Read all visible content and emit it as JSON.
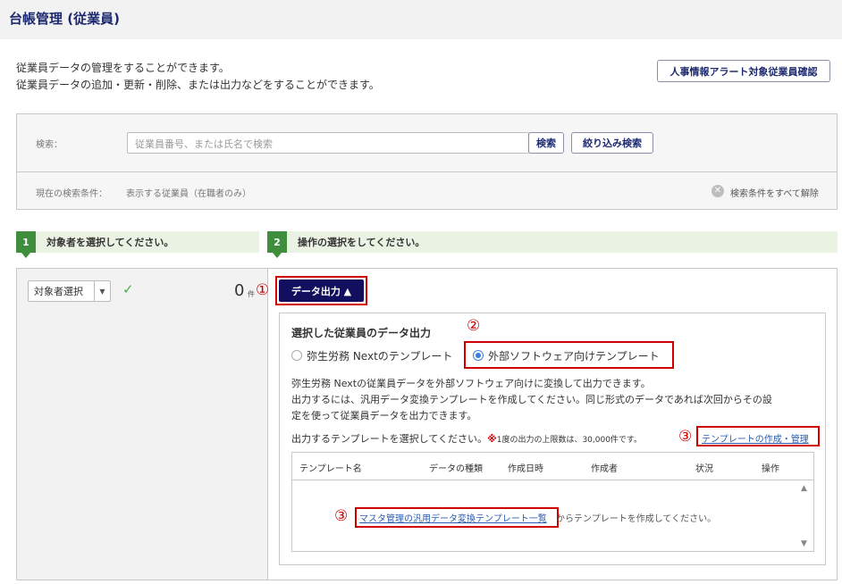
{
  "header": {
    "title": "台帳管理 (従業員)"
  },
  "description": {
    "line1": "従業員データの管理をすることができます。",
    "line2": "従業員データの追加・更新・削除、または出力などをすることができます。"
  },
  "alert_button": "人事情報アラート対象従業員確認",
  "search": {
    "label": "検索：",
    "placeholder": "従業員番号、または氏名で検索",
    "search_button": "検索",
    "filter_button": "絞り込み検索",
    "condition_label": "現在の検索条件：",
    "condition_value": "表示する従業員（在職者のみ）",
    "clear_label": "検索条件をすべて解除"
  },
  "steps": [
    {
      "num": "1",
      "label": "対象者を選択してください。"
    },
    {
      "num": "2",
      "label": "操作の選択をしてください。"
    }
  ],
  "selection": {
    "select_label": "対象者選択",
    "count": "0",
    "count_unit": "件"
  },
  "annotations": {
    "one": "①",
    "two": "②",
    "three": "③"
  },
  "export": {
    "button_label": "データ出力 ▲",
    "panel_title": "選択した従業員のデータ出力",
    "radio_options": [
      {
        "label": "弥生労務 Nextのテンプレート",
        "selected": false
      },
      {
        "label": "外部ソフトウェア向けテンプレート",
        "selected": true
      }
    ],
    "body_lines": [
      "弥生労務 Nextの従業員データを外部ソフトウェア向けに変換して出力できます。",
      "出力するには、汎用データ変換テンプレートを作成してください。同じ形式のデータであれば次回からその設",
      "定を使って従業員データを出力できます。"
    ],
    "select_prompt": "出力するテンプレートを選択してください。",
    "note_mark": "※",
    "note_text": "1度の出力の上限数は、30,000件です。",
    "template_link": "テンプレートの作成・管理",
    "table_headers": [
      "テンプレート名",
      "データの種類",
      "作成日時",
      "作成者",
      "状況",
      "操作"
    ],
    "empty_link": "マスタ管理の汎用データ変換テンプレート一覧",
    "empty_text": "からテンプレートを作成してください。"
  },
  "colors": {
    "accent_navy": "#12105e",
    "step_green": "#3e8e3e",
    "annotation_red": "#d00000",
    "link_blue": "#2a5db0"
  }
}
